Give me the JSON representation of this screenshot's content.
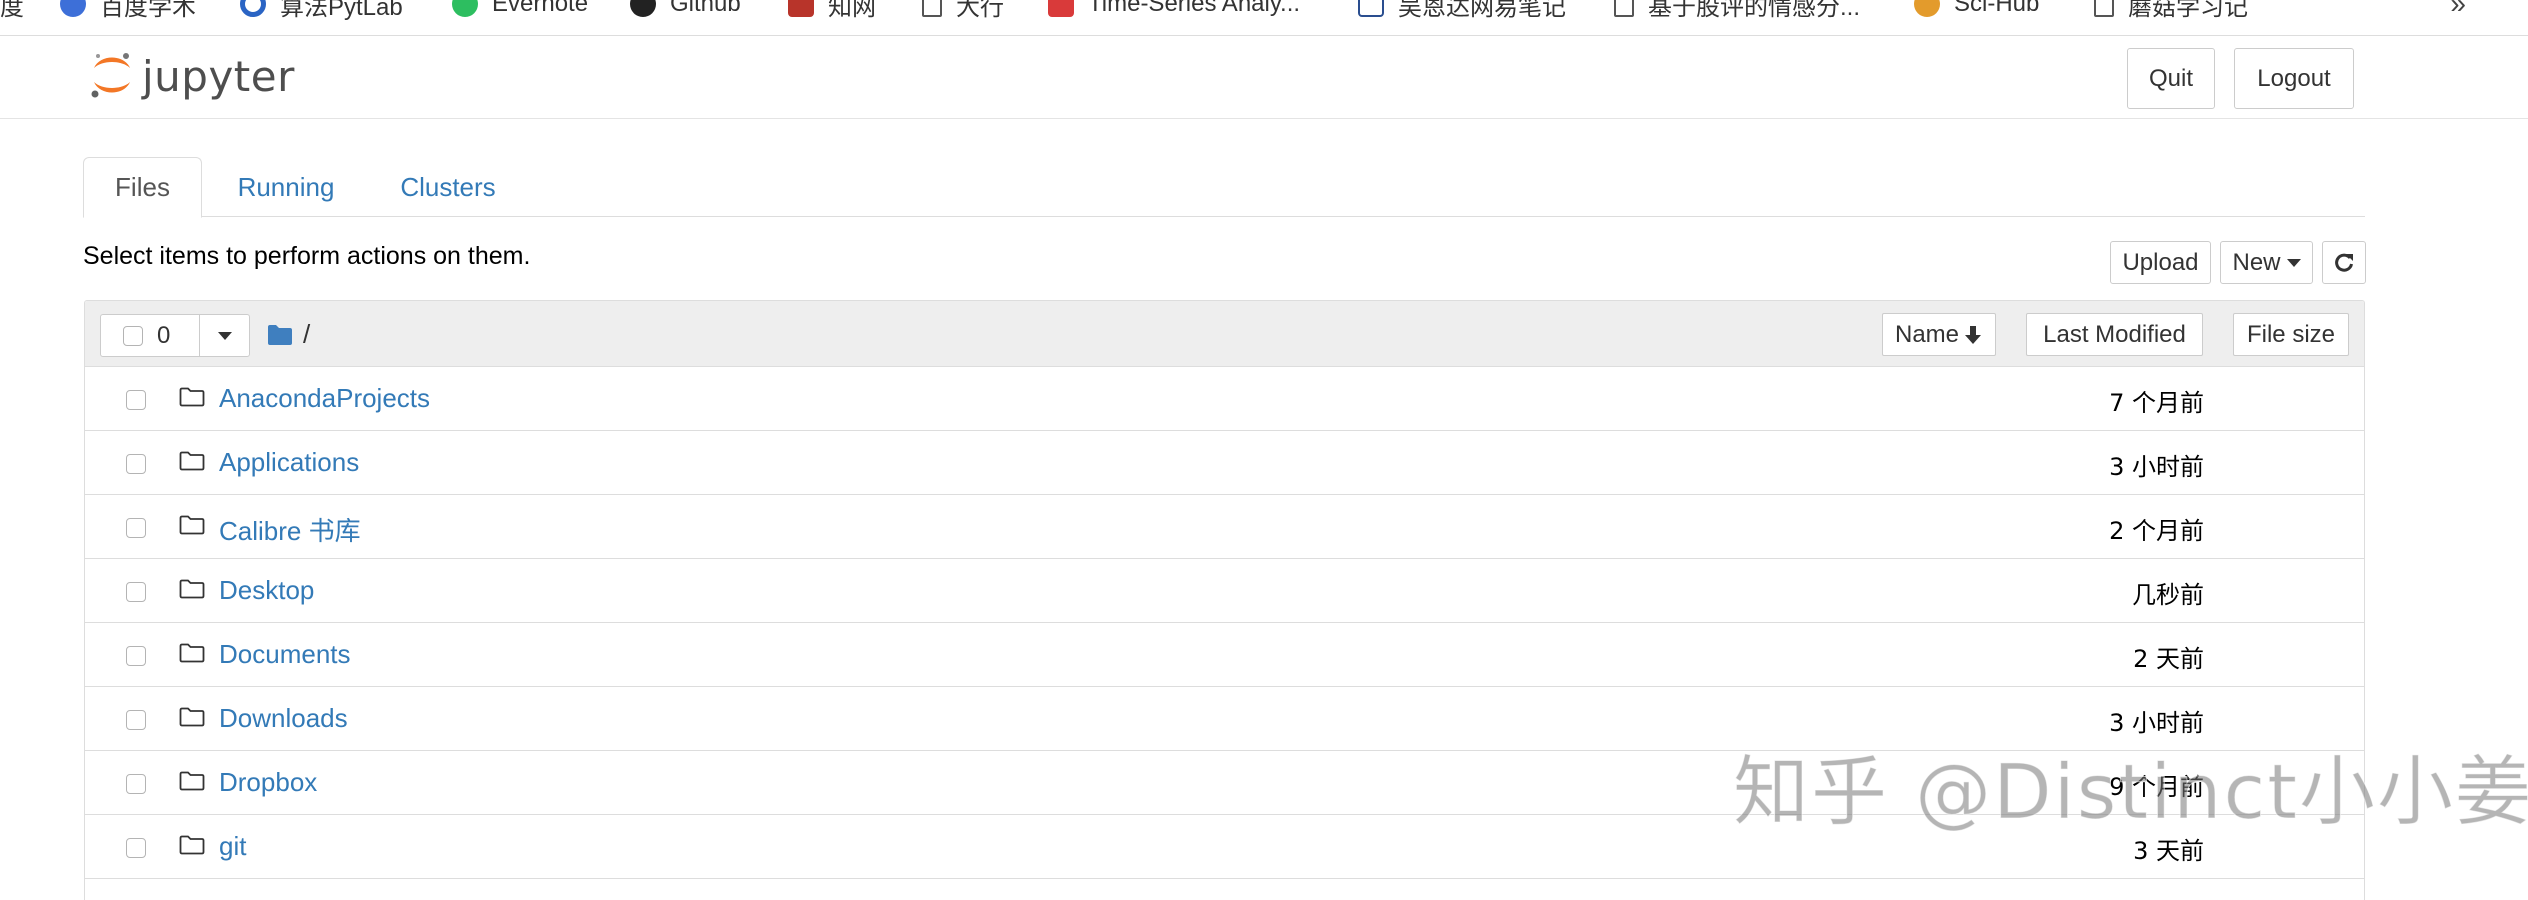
{
  "bookmarks": [
    {
      "label": "度",
      "icon": "none"
    },
    {
      "label": "百度学术",
      "icon": "paw-icon"
    },
    {
      "label": "算法PytLab",
      "icon": "c-logo-icon"
    },
    {
      "label": "Evernote",
      "icon": "elephant-icon"
    },
    {
      "label": "Github",
      "icon": "github-icon"
    },
    {
      "label": "知网",
      "icon": "cnki-icon"
    },
    {
      "label": "大行",
      "icon": "doc-icon"
    },
    {
      "label": "Time-Series Analy...",
      "icon": "red-square-icon"
    },
    {
      "label": "吴恩达网易笔记",
      "icon": "nb-icon"
    },
    {
      "label": "基于股评的情感分...",
      "icon": "doc-icon"
    },
    {
      "label": "Sci-Hub",
      "icon": "raven-icon"
    },
    {
      "label": "蘑菇学习记",
      "icon": "doc-icon"
    }
  ],
  "bookmarks_more": "»",
  "header": {
    "logo_text": "jupyter",
    "quit_label": "Quit",
    "logout_label": "Logout"
  },
  "tabs": [
    {
      "label": "Files",
      "active": true
    },
    {
      "label": "Running",
      "active": false
    },
    {
      "label": "Clusters",
      "active": false
    }
  ],
  "instructions": "Select items to perform actions on them.",
  "toolbar": {
    "upload_label": "Upload",
    "new_label": "New",
    "refresh_icon": "refresh-icon"
  },
  "list_header": {
    "selected_count": "0",
    "path_sep": "/",
    "name_label": "Name",
    "name_sort_icon": "arrow-down-icon",
    "last_modified_label": "Last Modified",
    "file_size_label": "File size"
  },
  "files": [
    {
      "name": "AnacondaProjects",
      "modified": "7 个月前"
    },
    {
      "name": "Applications",
      "modified": "3 小时前"
    },
    {
      "name": "Calibre 书库",
      "modified": "2 个月前"
    },
    {
      "name": "Desktop",
      "modified": "几秒前"
    },
    {
      "name": "Documents",
      "modified": "2 天前"
    },
    {
      "name": "Downloads",
      "modified": "3 小时前"
    },
    {
      "name": "Dropbox",
      "modified": "9 个月前"
    },
    {
      "name": "git",
      "modified": "3 天前"
    }
  ],
  "watermark": "知乎 @Distinct小小姜",
  "colors": {
    "link": "#337ab7",
    "jupyter_orange": "#f37726",
    "folder_blue": "#3f7fbf"
  }
}
